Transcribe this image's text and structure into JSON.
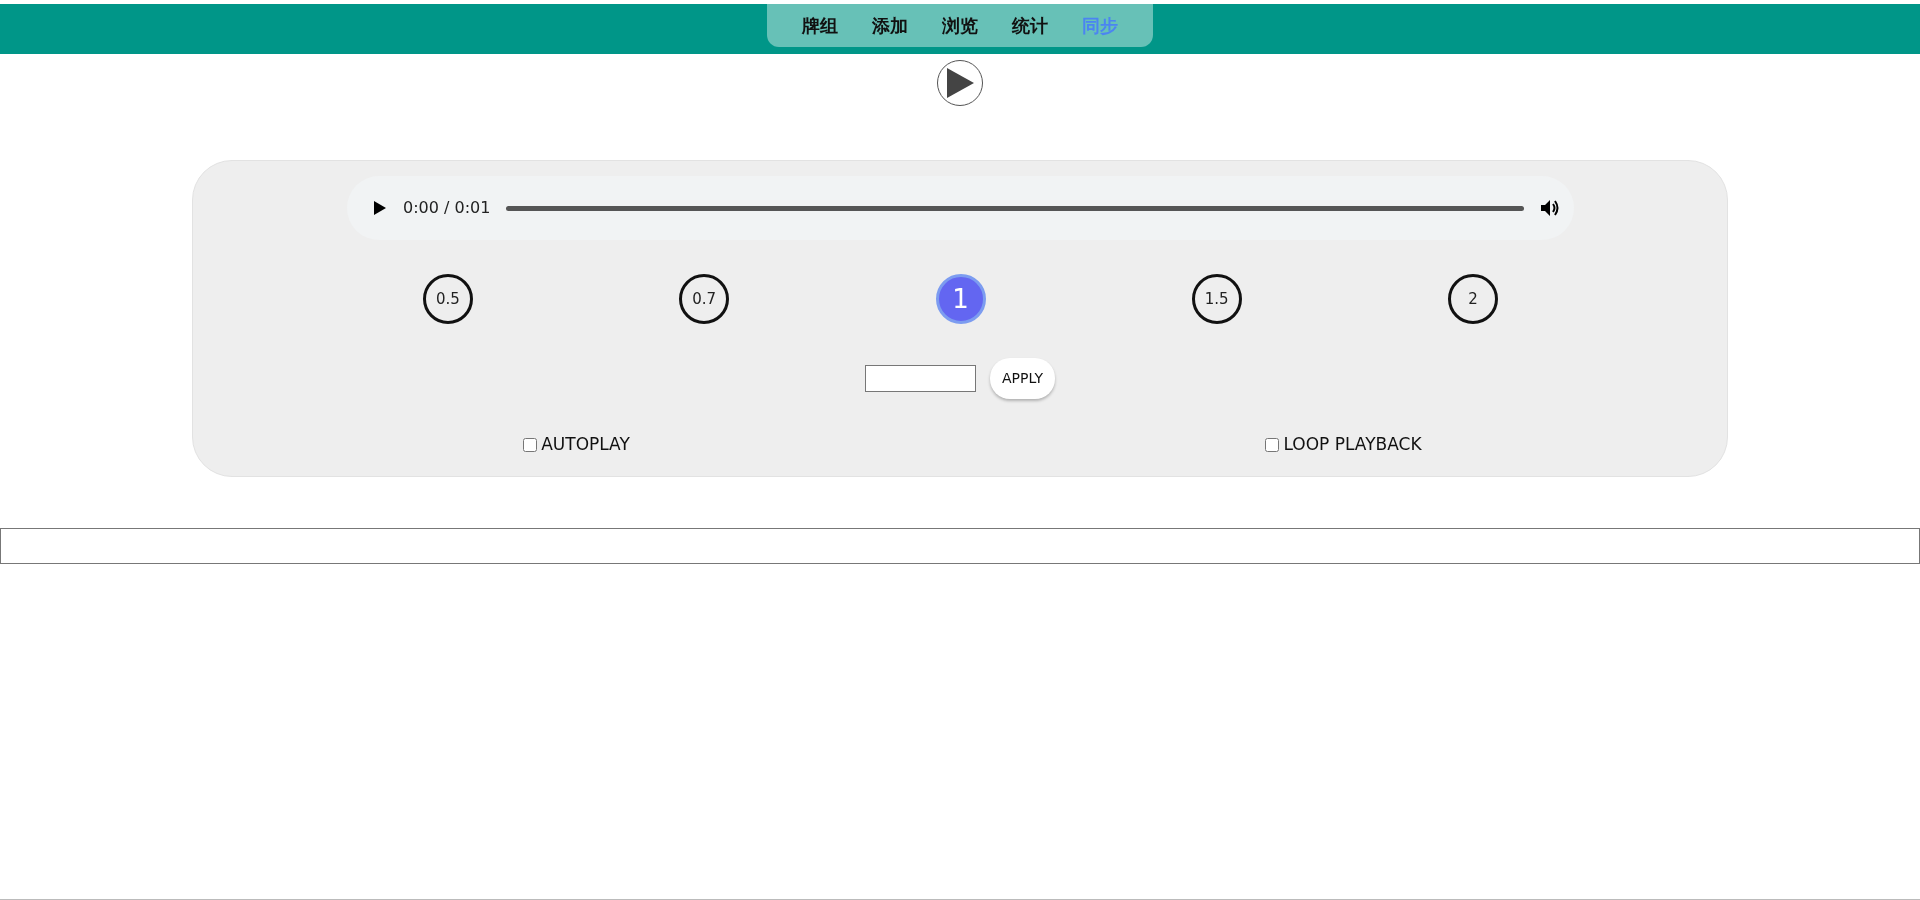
{
  "nav": {
    "tabs": [
      {
        "label": "牌组",
        "selected": false
      },
      {
        "label": "添加",
        "selected": false
      },
      {
        "label": "浏览",
        "selected": false
      },
      {
        "label": "统计",
        "selected": false
      },
      {
        "label": "同步",
        "selected": true
      }
    ]
  },
  "player": {
    "time": "0:00 / 0:01",
    "speeds": [
      {
        "label": "0.5",
        "selected": false
      },
      {
        "label": "0.7",
        "selected": false
      },
      {
        "label": "1",
        "selected": true
      },
      {
        "label": "1.5",
        "selected": false
      },
      {
        "label": "2",
        "selected": false
      }
    ],
    "apply_button": "APPLY",
    "options": [
      {
        "label": "AUTOPLAY",
        "checked": false
      },
      {
        "label": "LOOP PLAYBACK",
        "checked": false
      }
    ]
  }
}
